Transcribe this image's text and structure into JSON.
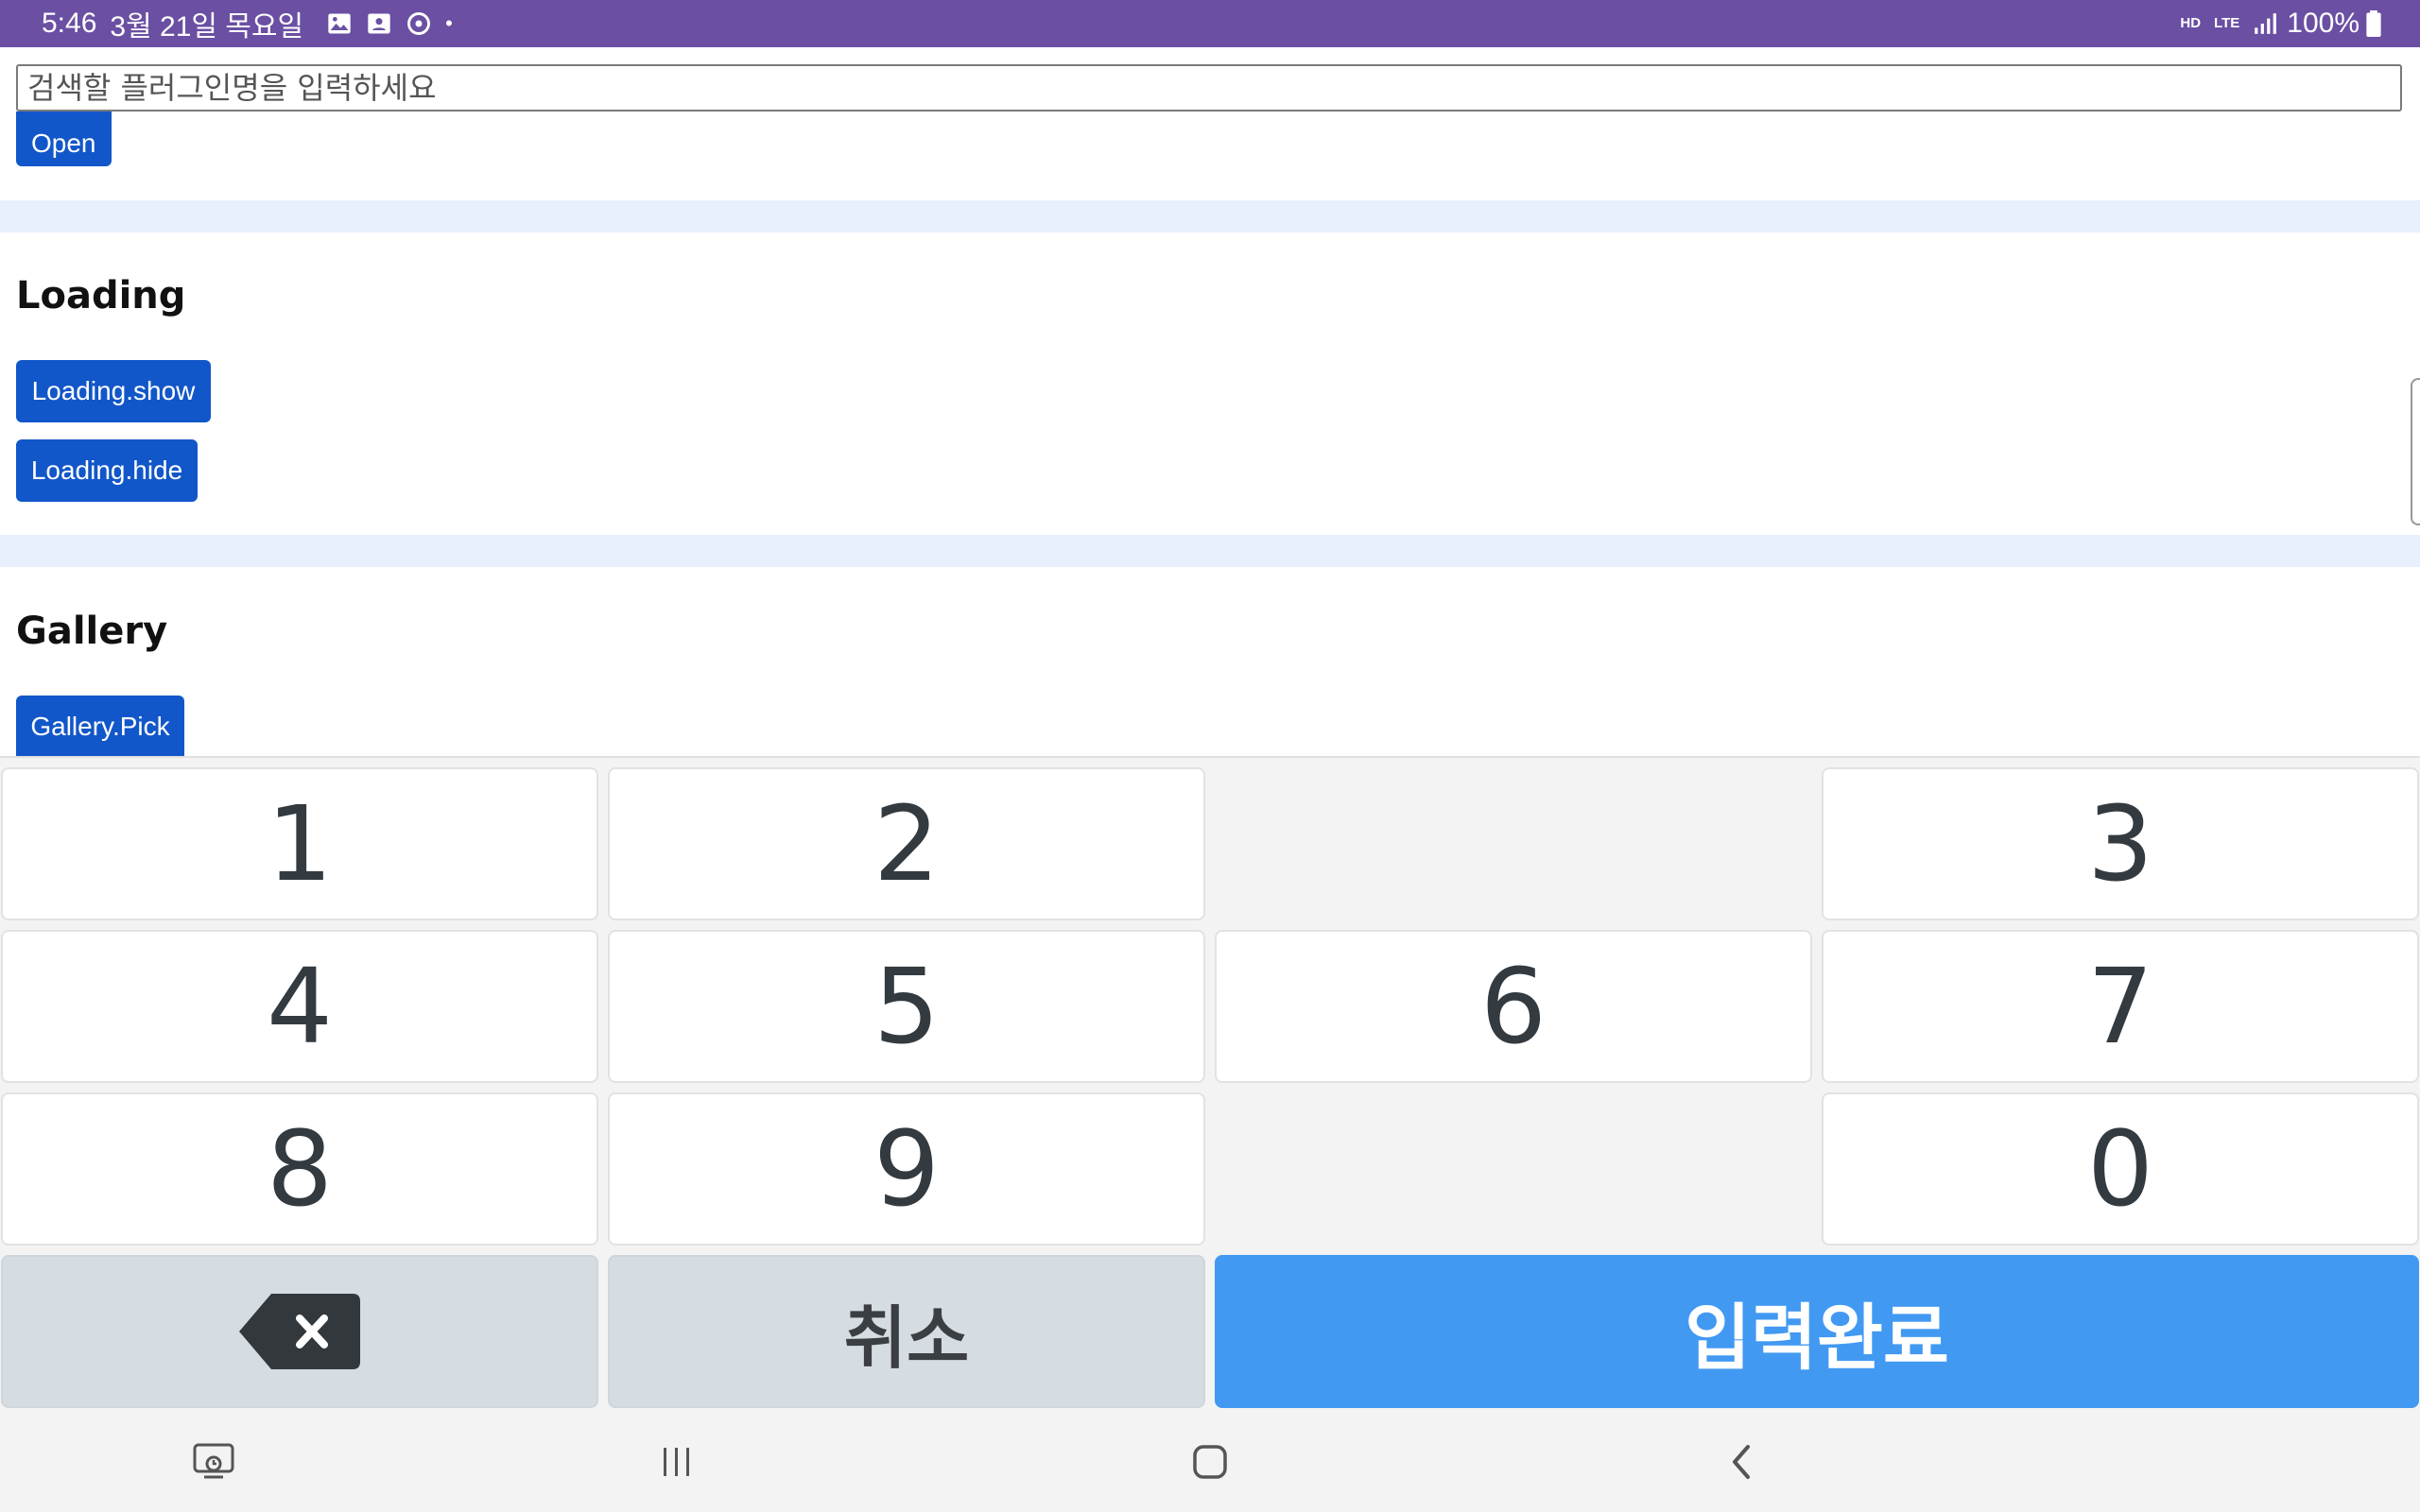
{
  "status_bar": {
    "time": "5:46",
    "date": "3월 21일 목요일",
    "dot": "•",
    "network_hd": "HD",
    "network_lte": "LTE",
    "battery": "100%",
    "icons": [
      "gallery-icon",
      "contact-card-icon",
      "sync-icon",
      "signal-icon",
      "battery-icon"
    ]
  },
  "search": {
    "placeholder": "검색할 플러그인명을 입력하세요",
    "value": ""
  },
  "sections": {
    "top": {
      "open_label": "Open"
    },
    "loading": {
      "title": "Loading",
      "show_label": "Loading.show",
      "hide_label": "Loading.hide"
    },
    "gallery": {
      "title": "Gallery",
      "pick_label": "Gallery.Pick"
    }
  },
  "keypad": {
    "row1": [
      "1",
      "2",
      "3"
    ],
    "row2": [
      "4",
      "5",
      "6",
      "7"
    ],
    "row3": [
      "8",
      "9",
      "0"
    ],
    "cancel_label": "취소",
    "done_label": "입력완료",
    "backspace_icon": "backspace-icon"
  },
  "nav_bar": {
    "icons": [
      "keyboard-switch-icon",
      "recent-apps-icon",
      "home-icon",
      "back-icon"
    ]
  },
  "colors": {
    "status_bar": "#6a4fa3",
    "button": "#1257c9",
    "section_divider": "#e8f0fd",
    "done_key": "#4299f2",
    "function_key": "#d6dde2"
  }
}
